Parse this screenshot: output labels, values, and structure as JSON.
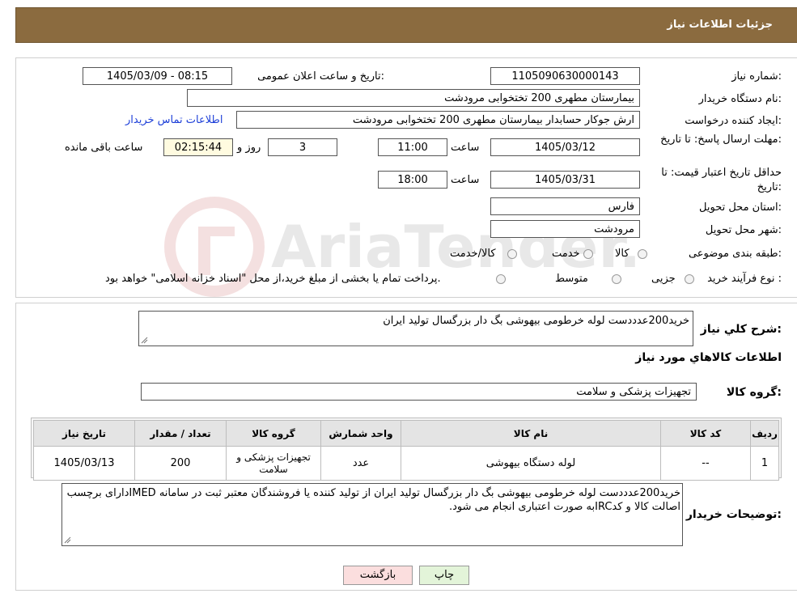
{
  "header": {
    "title": "جزئیات اطلاعات نیاز"
  },
  "form": {
    "need_number_label": "شماره نیاز:",
    "need_number": "1105090630000143",
    "announce_label": "تاریخ و ساعت اعلان عمومی:",
    "announce_value": "1405/03/09 - 08:15",
    "buyer_org_label": "نام دستگاه خریدار:",
    "buyer_org": "بیمارستان مطهری  200 تختخوابی مرودشت",
    "creator_label": "ایجاد کننده درخواست:",
    "creator": "ارش  جوکار حسابدار بیمارستان مطهری  200 تختخوابی مرودشت",
    "contact_link": "اطلاعات تماس خریدار",
    "reply_deadline_label": "مهلت ارسال پاسخ: تا تاریخ:",
    "reply_date": "1405/03/12",
    "time_label": "ساعت",
    "reply_time": "11:00",
    "days_value": "3",
    "days_label": "روز و",
    "remaining_time": "02:15:44",
    "remaining_label": "ساعت باقی مانده",
    "validity_label": "حداقل تاریخ اعتبار قیمت: تا تاریخ:",
    "validity_date": "1405/03/31",
    "validity_time": "18:00",
    "province_label": "استان محل تحویل:",
    "province": "فارس",
    "city_label": "شهر محل تحویل:",
    "city": "مرودشت",
    "category_label": "طبقه بندی موضوعی:",
    "category_options": [
      "کالا",
      "خدمت",
      "کالا/خدمت"
    ],
    "process_label": "نوع فرآیند خرید :",
    "process_options": [
      "جزیی",
      "متوسط"
    ],
    "process_note": "پرداخت تمام یا بخشی از مبلغ خرید،از محل \"اسناد خزانه اسلامی\" خواهد بود."
  },
  "details": {
    "description_label": "شرح کلي نیاز:",
    "description": "خرید200عدددست لوله خرطومی بیهوشی بگ دار بزرگسال تولید ایران",
    "items_heading": "اطلاعات کالاهاي مورد نیاز",
    "group_label": "گروه کالا:",
    "group_value": "تجهیزات پزشکی و سلامت",
    "table": {
      "headers": [
        "ردیف",
        "کد کالا",
        "نام کالا",
        "واحد شمارش",
        "گروه کالا",
        "تعداد / مقدار",
        "تاریخ نیاز"
      ],
      "rows": [
        [
          "1",
          "--",
          "لوله دستگاه بیهوشی",
          "عدد",
          "تجهیزات پزشکی و سلامت",
          "200",
          "1405/03/13"
        ]
      ]
    },
    "buyer_notes_label": "توضیحات خریدار:",
    "buyer_notes": "خرید200عدددست لوله خرطومی بیهوشی بگ دار بزرگسال تولید ایران از تولید کننده یا فروشندگان معتبر ثبت در سامانه IMEDدارای برچسب اصالت کالا و کدIRCبه صورت اعتباری انجام می شود."
  },
  "buttons": {
    "print": "چاپ",
    "back": "بازگشت"
  },
  "colors": {
    "header_bg": "#8b6b3f",
    "link": "#1d3fd8",
    "back_bg": "#fbdede",
    "print_bg": "#e3f4d9"
  },
  "watermark": {
    "text": "AriaTender.neT"
  }
}
